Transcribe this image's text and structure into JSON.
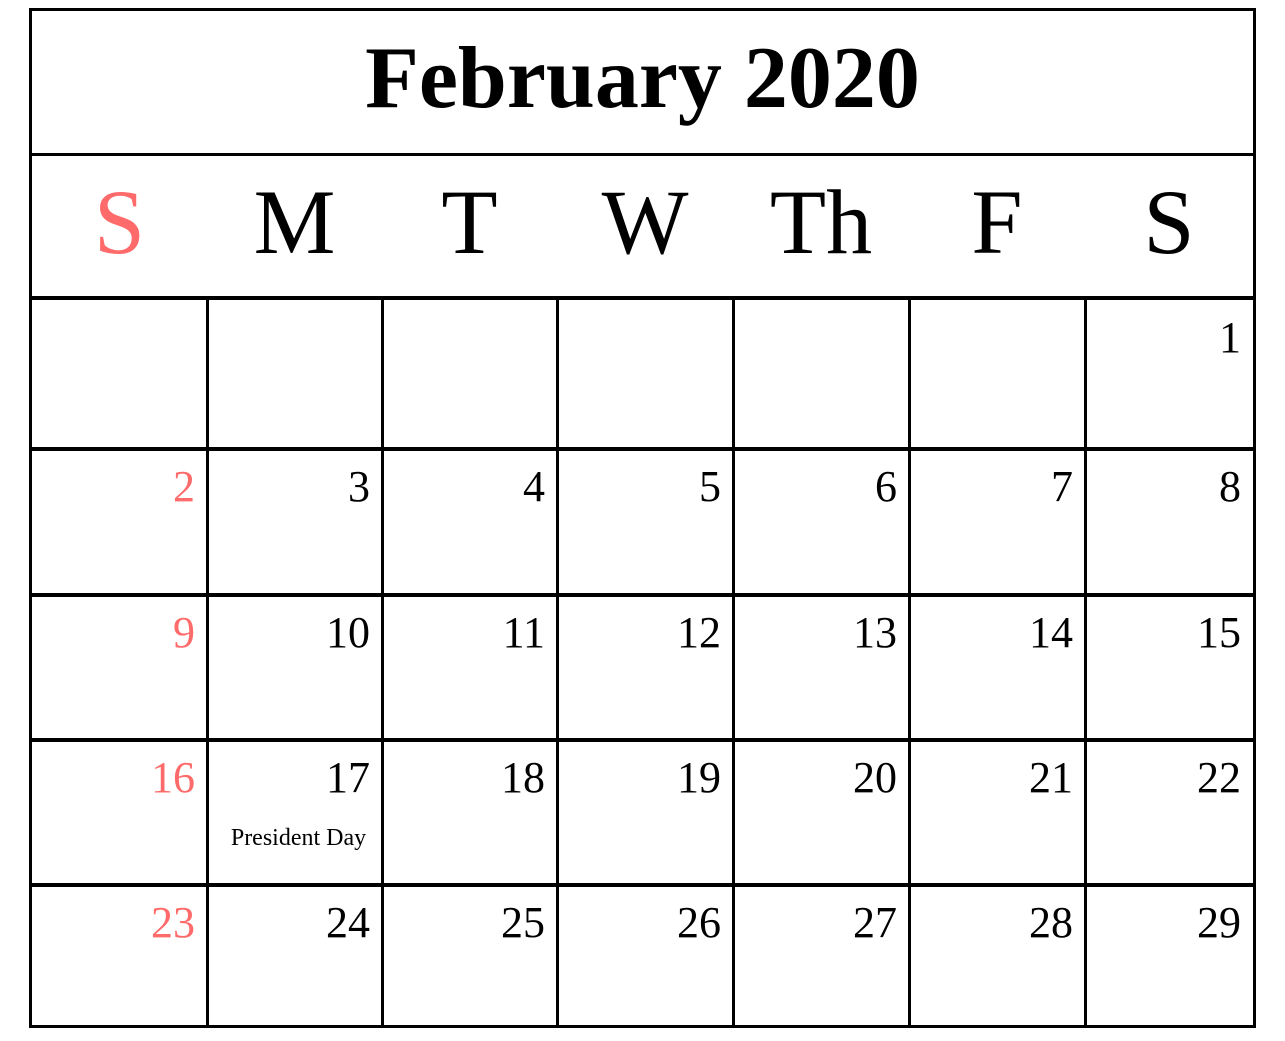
{
  "title": "February 2020",
  "accent_color": "#ff6b6b",
  "weekdays": [
    "S",
    "M",
    "T",
    "W",
    "Th",
    "F",
    "S"
  ],
  "weeks": [
    [
      {
        "day": ""
      },
      {
        "day": ""
      },
      {
        "day": ""
      },
      {
        "day": ""
      },
      {
        "day": ""
      },
      {
        "day": ""
      },
      {
        "day": "1"
      }
    ],
    [
      {
        "day": "2"
      },
      {
        "day": "3"
      },
      {
        "day": "4"
      },
      {
        "day": "5"
      },
      {
        "day": "6"
      },
      {
        "day": "7"
      },
      {
        "day": "8"
      }
    ],
    [
      {
        "day": "9"
      },
      {
        "day": "10"
      },
      {
        "day": "11"
      },
      {
        "day": "12"
      },
      {
        "day": "13"
      },
      {
        "day": "14"
      },
      {
        "day": "15"
      }
    ],
    [
      {
        "day": "16"
      },
      {
        "day": "17",
        "event": "President Day"
      },
      {
        "day": "18"
      },
      {
        "day": "19"
      },
      {
        "day": "20"
      },
      {
        "day": "21"
      },
      {
        "day": "22"
      }
    ],
    [
      {
        "day": "23"
      },
      {
        "day": "24"
      },
      {
        "day": "25"
      },
      {
        "day": "26"
      },
      {
        "day": "27"
      },
      {
        "day": "28"
      },
      {
        "day": "29"
      }
    ]
  ]
}
